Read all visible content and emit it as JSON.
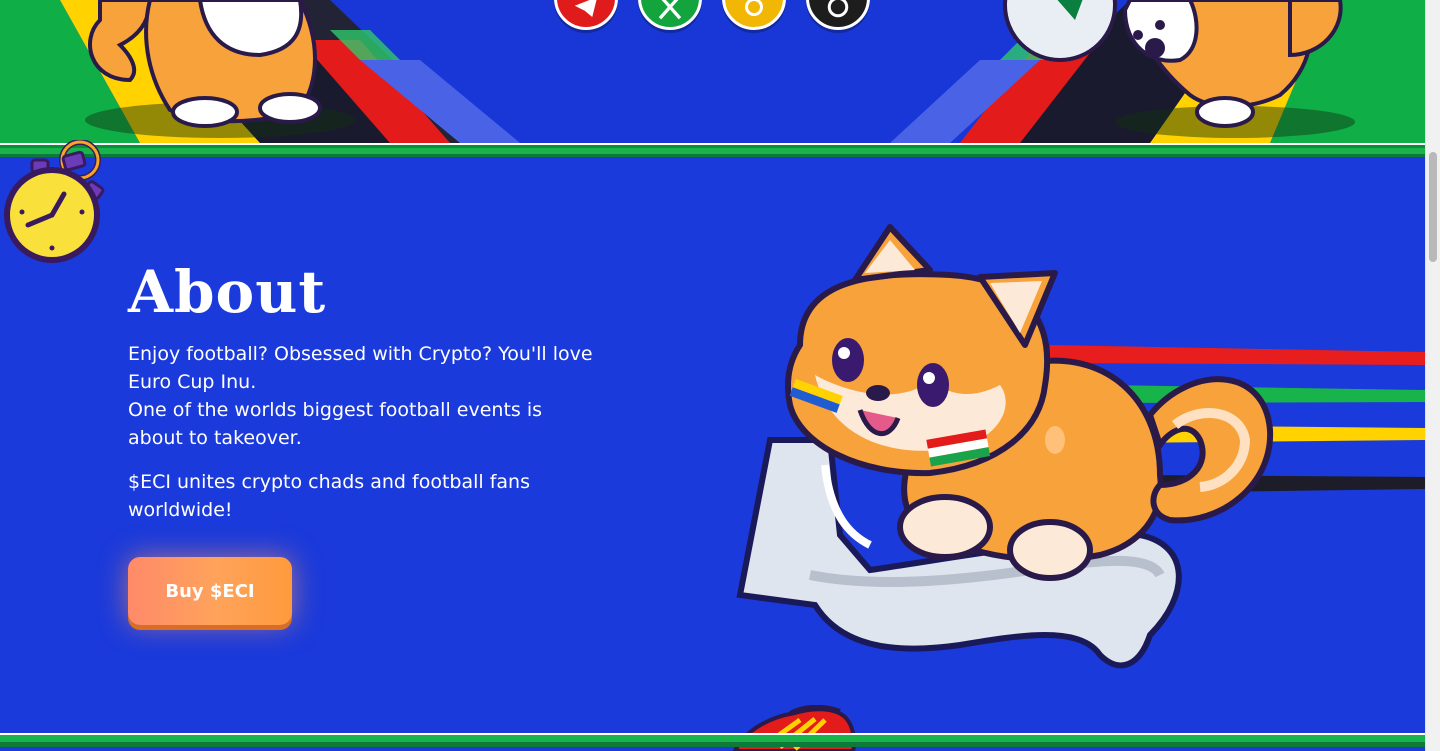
{
  "hero": {
    "social_links": [
      {
        "name": "telegram",
        "label": "Telegram",
        "color": "#e01b1b",
        "icon": "telegram-icon"
      },
      {
        "name": "x",
        "label": "X",
        "color": "#13a43e",
        "icon": "x-icon"
      },
      {
        "name": "coingecko",
        "label": "CoinGecko",
        "color": "#f2b705",
        "icon": "coingecko-icon"
      },
      {
        "name": "dextools",
        "label": "DEXTools",
        "color": "#1d1d1d",
        "icon": "dextools-icon"
      }
    ]
  },
  "about": {
    "title": "About",
    "line1": "Enjoy football? Obsessed with Crypto? You'll love Euro Cup Inu.",
    "line2": "One of the worlds biggest football events is about to takeover.",
    "line3": "$ECI unites crypto chads and football fans worldwide!",
    "buy_label": "Buy $ECI"
  },
  "colors": {
    "background": "#1b3adb",
    "accent": "#ff9a3c",
    "green": "#19b34b"
  }
}
